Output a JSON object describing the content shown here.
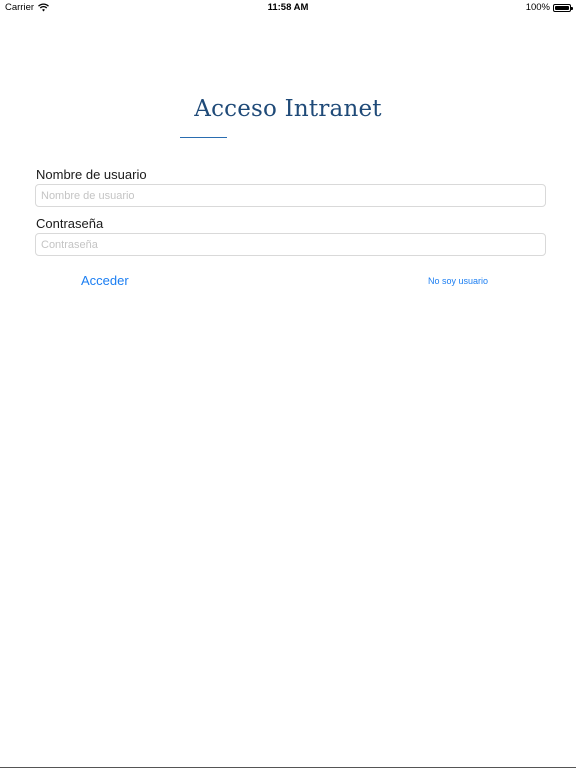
{
  "status_bar": {
    "carrier": "Carrier",
    "time": "11:58 AM",
    "battery": "100%",
    "wifi_icon": "wifi-icon",
    "battery_icon": "battery-icon"
  },
  "login": {
    "title": "Acceso Intranet",
    "username_label": "Nombre de usuario",
    "username_placeholder": "Nombre de usuario",
    "password_label": "Contraseña",
    "password_placeholder": "Contraseña",
    "submit_label": "Acceder",
    "not_user_label": "No soy usuario"
  },
  "colors": {
    "title": "#1f4a78",
    "accent_line": "#2a6db0",
    "link": "#1b7ef2",
    "input_border": "#d9d9d9",
    "placeholder": "#c4c4c4"
  }
}
